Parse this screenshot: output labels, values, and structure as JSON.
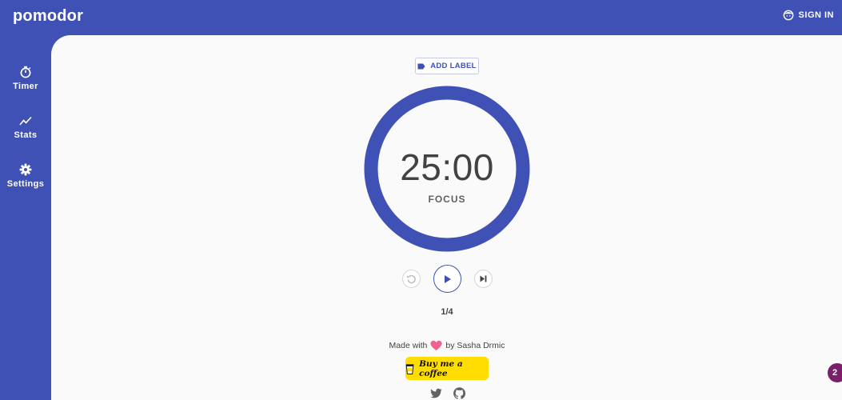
{
  "app": {
    "logo_text": "pomodor"
  },
  "header": {
    "signin_label": "SIGN IN",
    "signin_icon": "face-icon"
  },
  "sidebar": {
    "items": [
      {
        "label": "Timer",
        "icon": "stopwatch-icon"
      },
      {
        "label": "Stats",
        "icon": "trend-line-icon"
      },
      {
        "label": "Settings",
        "icon": "gear-icon"
      }
    ]
  },
  "main": {
    "add_label_text": "ADD LABEL",
    "timer_value": "25:00",
    "mode_label": "FOCUS",
    "progress_fraction": 1.0,
    "round_text": "1/4",
    "credit": {
      "prefix": "Made with",
      "suffix": "by Sasha Drmic"
    },
    "coffee_label": "Buy me a coffee",
    "social": [
      "twitter-icon",
      "github-icon"
    ]
  },
  "badge": {
    "count": "2"
  },
  "colors": {
    "primary": "#3f51b5",
    "background": "#fafafa",
    "heart": "#f06292",
    "coffee": "#ffdd00",
    "badge": "#7b1f6a"
  }
}
